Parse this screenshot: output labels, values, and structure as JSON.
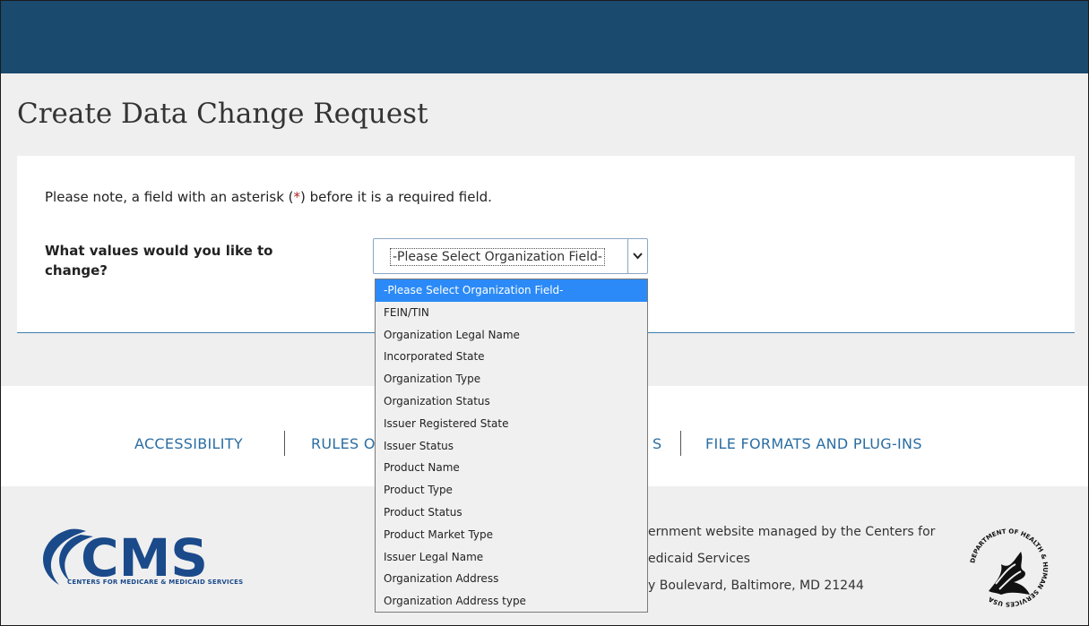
{
  "page": {
    "title": "Create Data Change Request"
  },
  "form": {
    "note_before": "Please note, a field with an asterisk (",
    "note_asterisk": "*",
    "note_after": ") before it is a required field.",
    "question": "What values would you like to change?",
    "select_value": "-Please Select Organization Field-"
  },
  "dropdown": {
    "options": [
      "-Please Select Organization Field-",
      "FEIN/TIN",
      "Organization Legal Name",
      "Incorporated State",
      "Organization Type",
      "Organization Status",
      "Issuer Registered State",
      "Issuer Status",
      "Product Name",
      "Product Type",
      "Product Status",
      "Product Market Type",
      "Issuer Legal Name",
      "Organization Address",
      "Organization Address type"
    ],
    "selected_index": 0
  },
  "links": {
    "accessibility": "ACCESSIBILITY",
    "rules_partial": "RULES O",
    "partial_s": "S",
    "file_formats": "FILE FORMATS AND PLUG-INS"
  },
  "footer": {
    "logo_text": "CMS",
    "logo_subtitle": "CENTERS FOR MEDICARE & MEDICAID SERVICES",
    "line1": "ernment website managed by the Centers for",
    "line2": "edicaid Services",
    "line3": "y Boulevard, Baltimore, MD 21244",
    "seal_text": "DEPARTMENT OF HEALTH & HUMAN SERVICES USA"
  },
  "colors": {
    "header": "#1a4a6e",
    "link": "#2a6da3",
    "selected": "#2b8af7",
    "asterisk": "#b22222"
  }
}
